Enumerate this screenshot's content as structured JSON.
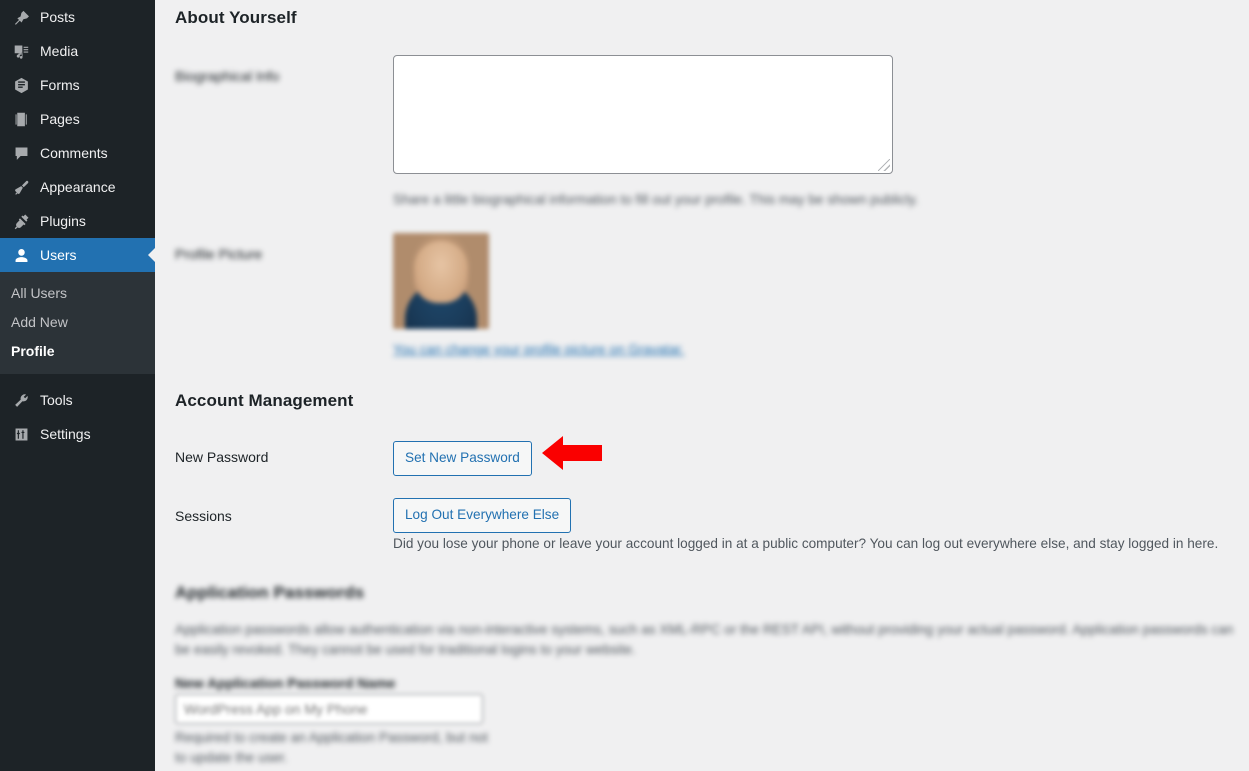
{
  "sidebar": {
    "items": [
      {
        "label": "Posts",
        "icon": "pushpin-icon",
        "current": false
      },
      {
        "label": "Media",
        "icon": "media-icon",
        "current": false
      },
      {
        "label": "Forms",
        "icon": "forms-icon",
        "current": false
      },
      {
        "label": "Pages",
        "icon": "pages-icon",
        "current": false
      },
      {
        "label": "Comments",
        "icon": "comment-icon",
        "current": false
      },
      {
        "label": "Appearance",
        "icon": "paintbrush-icon",
        "current": false
      },
      {
        "label": "Plugins",
        "icon": "plug-icon",
        "current": false
      },
      {
        "label": "Users",
        "icon": "user-icon",
        "current": true
      }
    ],
    "submenu": [
      {
        "label": "All Users",
        "current": false
      },
      {
        "label": "Add New",
        "current": false
      },
      {
        "label": "Profile",
        "current": true
      }
    ],
    "items_after": [
      {
        "label": "Tools",
        "icon": "wrench-icon",
        "current": false
      },
      {
        "label": "Settings",
        "icon": "sliders-icon",
        "current": false
      }
    ],
    "active_color": "#2271b1",
    "background_color": "#1d2327",
    "submenu_background_color": "#2c3338"
  },
  "main": {
    "about_yourself": {
      "heading": "About Yourself",
      "bio_label": "Biographical Info",
      "bio_value": "",
      "bio_description": "Share a little biographical information to fill out your profile. This may be shown publicly.",
      "picture_label": "Profile Picture",
      "gravatar_link": "You can change your profile picture on Gravatar."
    },
    "account_management": {
      "heading": "Account Management",
      "new_password_label": "New Password",
      "set_new_password_button": "Set New Password",
      "sessions_label": "Sessions",
      "log_out_everywhere_button": "Log Out Everywhere Else",
      "sessions_description": "Did you lose your phone or leave your account logged in at a public computer? You can log out everywhere else, and stay logged in here."
    },
    "application_passwords": {
      "heading": "Application Passwords",
      "description": "Application passwords allow authentication via non-interactive systems, such as XML-RPC or the REST API, without providing your actual password. Application passwords can be easily revoked. They cannot be used for traditional logins to your website.",
      "new_name_label": "New Application Password Name",
      "new_name_placeholder": "WordPress App on My Phone",
      "new_name_description": "Required to create an Application Password, but not to update the user."
    }
  },
  "annotation": {
    "arrow_direction": "left",
    "arrow_color": "#fa0000",
    "points_at": "Set New Password"
  }
}
